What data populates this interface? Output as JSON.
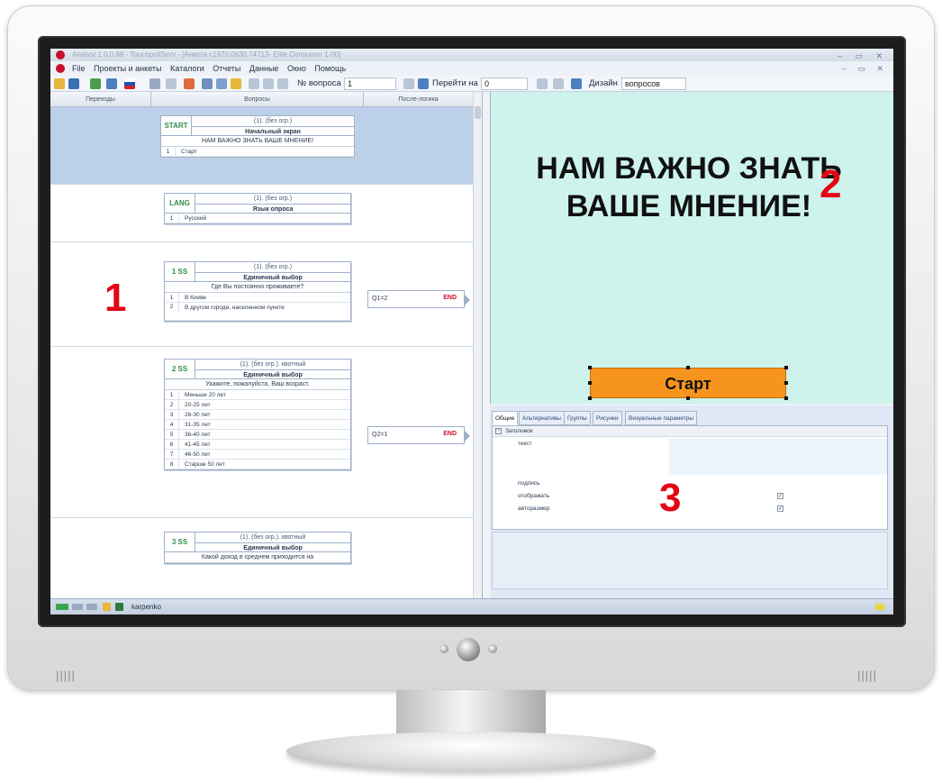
{
  "window": {
    "title": "Analyst 1.0.0.88 - TouchpoltServ - [Анкета с1970.0630.74713- Elite Consumer 1-00]",
    "controls": "– ▭ ✕"
  },
  "menu": {
    "items": [
      "File",
      "Проекты и анкеты",
      "Каталоги",
      "Отчеты",
      "Данные",
      "Окно",
      "Помощь"
    ],
    "mdi_controls": "– ▭ ✕"
  },
  "toolbar": {
    "question_no_label": "№ вопроса",
    "question_no_value": "1",
    "goto_label": "Перейти на",
    "goto_value": "0",
    "design_label": "Дизайн",
    "design_value": "вопросов"
  },
  "left_panel": {
    "columns": [
      "Переходы",
      "Вопросы",
      "После-логика"
    ],
    "questions": [
      {
        "code": "START",
        "limit": "(1). (без огр.)",
        "type": "Начальный экран",
        "text": "НАМ ВАЖНО ЗНАТЬ ВАШЕ МНЕНИЕ!",
        "options": [
          {
            "n": "1",
            "label": "Старт"
          }
        ]
      },
      {
        "code": "LANG",
        "limit": "(1). (без огр.)",
        "type": "Язык опроса",
        "text": "",
        "options": [
          {
            "n": "1",
            "label": "Русский"
          }
        ]
      },
      {
        "code": "1 SS",
        "limit": "(1). (без огр.)",
        "type": "Единичный выбор",
        "text": "Где Вы постоянно проживаете?",
        "options": [
          {
            "n": "1",
            "label": "В Киеве"
          },
          {
            "n": "2",
            "label": "В другом городе, населенном пункте"
          }
        ]
      },
      {
        "code": "2 SS",
        "limit": "(1). (без огр.). квотный",
        "type": "Единичный выбор",
        "text": "Укажите, пожалуйста, Ваш возраст.",
        "options": [
          {
            "n": "1",
            "label": "Меньше 20 лет"
          },
          {
            "n": "2",
            "label": "20-25 лет"
          },
          {
            "n": "3",
            "label": "26-30 лет"
          },
          {
            "n": "4",
            "label": "31-35 лет"
          },
          {
            "n": "5",
            "label": "36-40 лет"
          },
          {
            "n": "6",
            "label": "41-45 лет"
          },
          {
            "n": "7",
            "label": "46-50 лет"
          },
          {
            "n": "8",
            "label": "Старше 50 лет"
          }
        ]
      },
      {
        "code": "3 SS",
        "limit": "(1). (без огр.). квотный",
        "type": "Единичный выбор",
        "text": "Какой доход в среднем приходится на",
        "options": []
      }
    ],
    "logic": [
      {
        "condition": "Q1=2",
        "target": "END"
      },
      {
        "condition": "Q2=1",
        "target": "END"
      }
    ]
  },
  "preview": {
    "title": "НАМ ВАЖНО ЗНАТЬ ВАШЕ МНЕНИЕ!",
    "start_button": "Старт",
    "background": "#cdf3ec",
    "button_color": "#f7941d"
  },
  "properties": {
    "tabs": [
      "Общие",
      "Альтернативы",
      "Группы",
      "Рисунки",
      "Визуальные параметры"
    ],
    "section": "Заголовок",
    "rows": [
      {
        "label": "текст",
        "checked": null
      },
      {
        "label": "подпись",
        "checked": null
      },
      {
        "label": "отображать",
        "checked": "✓"
      },
      {
        "label": "авторазмер",
        "checked": "✓"
      }
    ]
  },
  "status": {
    "user": "karpenko"
  },
  "region_numbers": [
    "1",
    "2",
    "3"
  ],
  "colors": {
    "accent_red": "#e30613",
    "green_code": "#2f8f46"
  }
}
